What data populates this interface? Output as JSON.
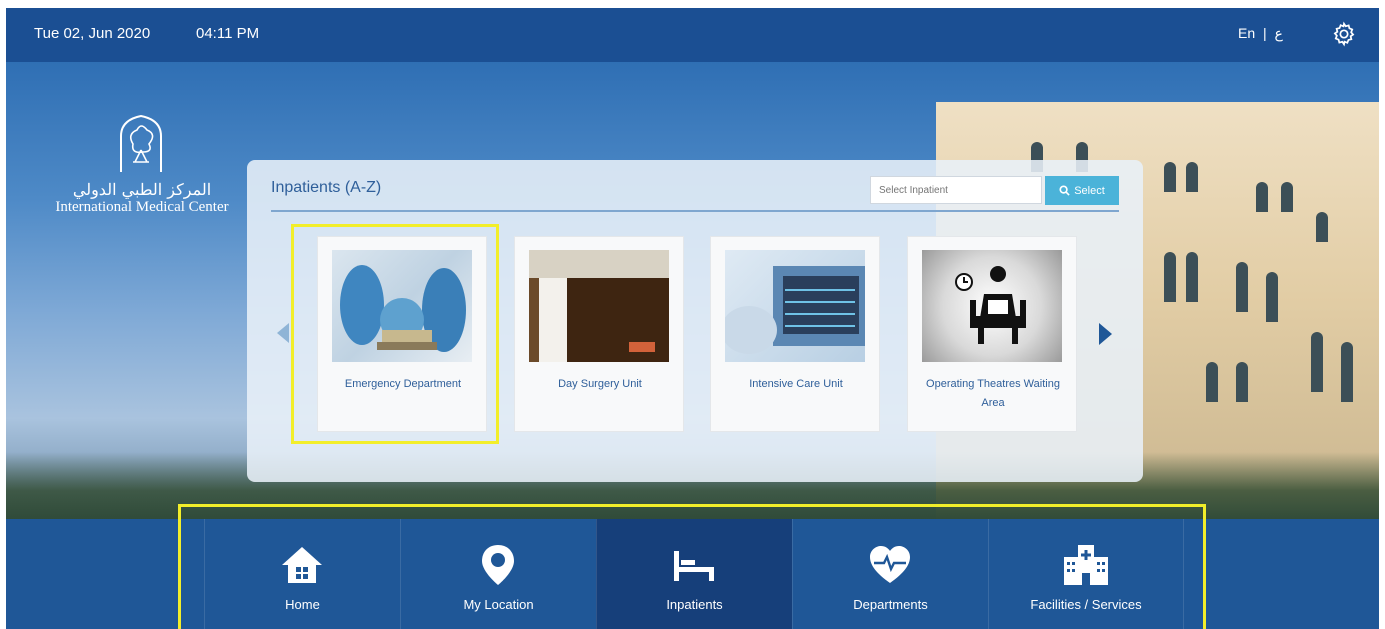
{
  "topbar": {
    "date": "Tue 02, Jun 2020",
    "time": "04:11 PM",
    "lang_en": "En",
    "lang_sep": "|",
    "lang_ar": "ع"
  },
  "logo": {
    "arabic": "المركز الطبي الدولي",
    "english": "International Medical Center"
  },
  "panel": {
    "title": "Inpatients (A-Z)",
    "search_placeholder": "Select Inpatient",
    "search_button": "Select",
    "cards": [
      {
        "label": "Emergency Department",
        "selected": true
      },
      {
        "label": "Day Surgery Unit",
        "selected": false
      },
      {
        "label": "Intensive Care Unit",
        "selected": false
      },
      {
        "label": "Operating Theatres Waiting Area",
        "selected": false
      }
    ]
  },
  "nav": [
    {
      "label": "Home",
      "icon": "home-icon",
      "active": false
    },
    {
      "label": "My Location",
      "icon": "location-pin-icon",
      "active": false
    },
    {
      "label": "Inpatients",
      "icon": "bed-icon",
      "active": true
    },
    {
      "label": "Departments",
      "icon": "heartbeat-icon",
      "active": false
    },
    {
      "label": "Facilities / Services",
      "icon": "hospital-icon",
      "active": false
    }
  ],
  "colors": {
    "primary": "#1f5797",
    "active_nav": "#163f7a",
    "accent": "#4bb3d9",
    "highlight": "#f2ee2a"
  }
}
